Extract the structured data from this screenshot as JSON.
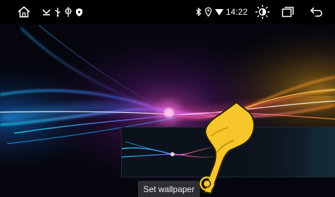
{
  "status_bar": {
    "time": "14:22",
    "left_icons": [
      "home-icon",
      "usb-icon",
      "usb-icon",
      "sd-card-icon",
      "shield-icon"
    ],
    "right_icons": [
      "bluetooth-icon",
      "location-icon",
      "wifi-icon",
      "brightness-icon",
      "recent-apps-icon",
      "back-icon"
    ]
  },
  "wallpaper_preview": {
    "toast_label": "Set wallpaper"
  },
  "colors": {
    "status_bar_bg": "#000000",
    "toast_bg": "#2d2f33",
    "gesture_hand": "#f7c62b",
    "gesture_outline": "#2a2100"
  }
}
